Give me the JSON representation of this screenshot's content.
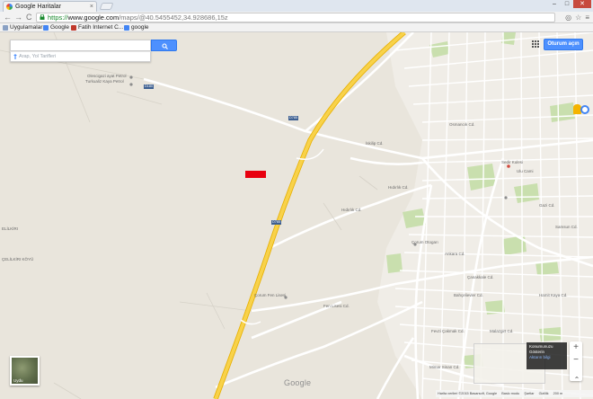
{
  "browser": {
    "tab_title": "Google Haritalar",
    "tab_close": "×",
    "window_buttons": [
      "–",
      "□",
      "✕"
    ],
    "nav": {
      "back": "←",
      "forward": "→",
      "reload": "C"
    },
    "url": {
      "scheme": "https://",
      "host": "www.google.com",
      "path": "/maps/@40.5455452,34.928686,15z"
    },
    "toolbar_icons": [
      "◎",
      "☆",
      "≡"
    ],
    "bookmarks": [
      {
        "label": "Uygulamalar",
        "color": "#8aa1c4"
      },
      {
        "label": "Google",
        "color": "#4285f4"
      },
      {
        "label": "Fatih Internet C...",
        "color": "#c0392b"
      },
      {
        "label": "google",
        "color": "#4285f4"
      }
    ]
  },
  "maps": {
    "search": {
      "value": "",
      "placeholder": ""
    },
    "directions_text": "Arap, Yol Tarifleri",
    "signin_label": "Oturum açın",
    "earth_label": "Uydu",
    "google_logo": "Google",
    "tooltip_title": "Konumunuzu",
    "tooltip_line2": "Gösterin",
    "tooltip_sub": "Aktarın bilgi",
    "zoom_in": "+",
    "zoom_out": "−",
    "expand": "⌃",
    "footer": [
      "Harita verileri ©2015 Basarsoft, Google",
      "Baskı modu",
      "Şartlar",
      "Gizlilik",
      "200 m"
    ],
    "labels": [
      {
        "text": "Olescigazi ayat Petrol",
        "cls": "a"
      },
      {
        "text": "Turkualiz Kaya Petrol",
        "cls": "b"
      },
      {
        "text": "D180",
        "cls": "shield1"
      },
      {
        "text": "D785",
        "cls": "shield2"
      },
      {
        "text": "D785",
        "cls": "shield3"
      },
      {
        "text": "Sedir Kulesi",
        "cls": "c"
      },
      {
        "text": "İskilip Cd.",
        "cls": "d"
      },
      {
        "text": "Hıdırlık Cd.",
        "cls": "e"
      },
      {
        "text": "Hıdırlık Cd.",
        "cls": "f"
      },
      {
        "text": "Çorum Otogarı",
        "cls": "g"
      },
      {
        "text": "Çorum Fen Lisesi",
        "cls": "h"
      },
      {
        "text": "Fen Lisesi Cd.",
        "cls": "i"
      },
      {
        "text": "Ankara Cd.",
        "cls": "j"
      },
      {
        "text": "Osmancık Cd.",
        "cls": "k"
      },
      {
        "text": "Çanakkale Cd.",
        "cls": "l"
      },
      {
        "text": "Gazi Cd.",
        "cls": "m"
      },
      {
        "text": "Bahçelievler Cd.",
        "cls": "n"
      },
      {
        "text": "Ulu Cami",
        "cls": "o"
      },
      {
        "text": "ELİLKİRI",
        "cls": "p"
      },
      {
        "text": "ÇELİLKİRI KÖYÜ",
        "cls": "q"
      },
      {
        "text": "Malazgirt Cd.",
        "cls": "r"
      },
      {
        "text": "Fevzi Çakmak Cd.",
        "cls": "s"
      },
      {
        "text": "Samsun Cd.",
        "cls": "t"
      },
      {
        "text": "Mimar Sinan Cd.",
        "cls": "u"
      },
      {
        "text": "Hamit Kaya Cd.",
        "cls": "v"
      }
    ]
  }
}
